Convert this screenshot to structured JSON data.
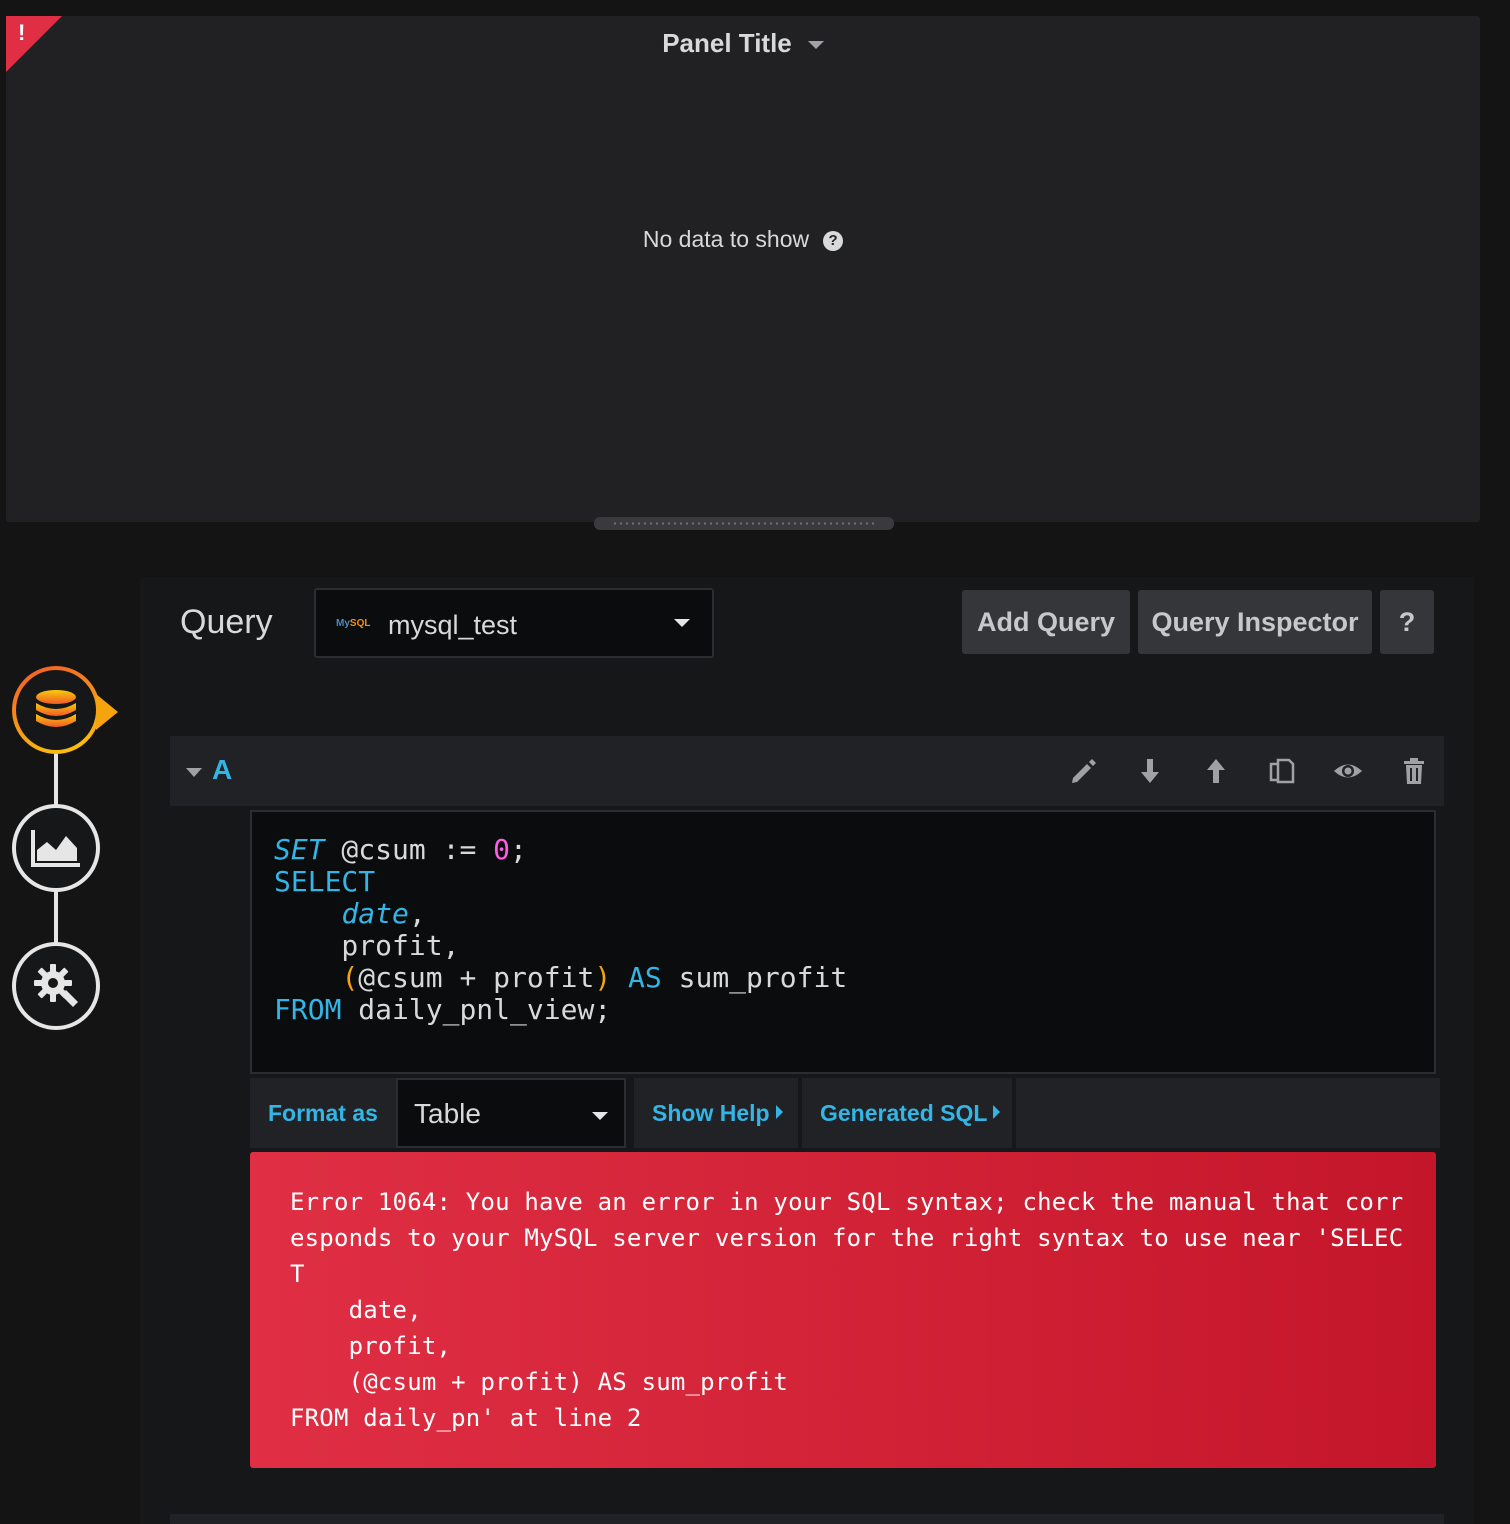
{
  "panel": {
    "title": "Panel Title",
    "no_data": "No data to show",
    "help_glyph": "?",
    "error_corner_glyph": "!"
  },
  "query_header": {
    "label": "Query",
    "datasource": "mysql_test",
    "datasource_logo_text": "MySQL",
    "add_query": "Add Query",
    "query_inspector": "Query Inspector",
    "help": "?"
  },
  "query_row": {
    "letter": "A",
    "icons": [
      "pencil-icon",
      "arrow-down-icon",
      "arrow-up-icon",
      "duplicate-icon",
      "eye-icon",
      "trash-icon"
    ]
  },
  "sql": {
    "line1_kw": "SET",
    "line1_var": " @csum := ",
    "line1_num": "0",
    "line1_end": ";",
    "line2_kw": "SELECT",
    "line3_indent": "    ",
    "line3_kw": "date",
    "line3_end": ",",
    "line4": "    profit,",
    "line5_indent": "    ",
    "line5_open": "(",
    "line5_mid": "@csum + profit",
    "line5_close": ")",
    "line5_sp": " ",
    "line5_kw": "AS",
    "line5_end": " sum_profit",
    "line6_kw": "FROM",
    "line6_end": " daily_pnl_view;"
  },
  "options": {
    "format_as": "Format as",
    "format_value": "Table",
    "show_help": "Show Help",
    "generated_sql": "Generated SQL"
  },
  "error": {
    "message": "Error 1064: You have an error in your SQL syntax; check the manual that corr\nesponds to your MySQL server version for the right syntax to use near 'SELEC\nT\n    date,\n    profit,\n    (@csum + profit) AS sum_profit\nFROM daily_pn' at line 2"
  },
  "colors": {
    "accent": "#33b5e5",
    "error": "#e02f44",
    "step_active": "#f5a30f"
  }
}
